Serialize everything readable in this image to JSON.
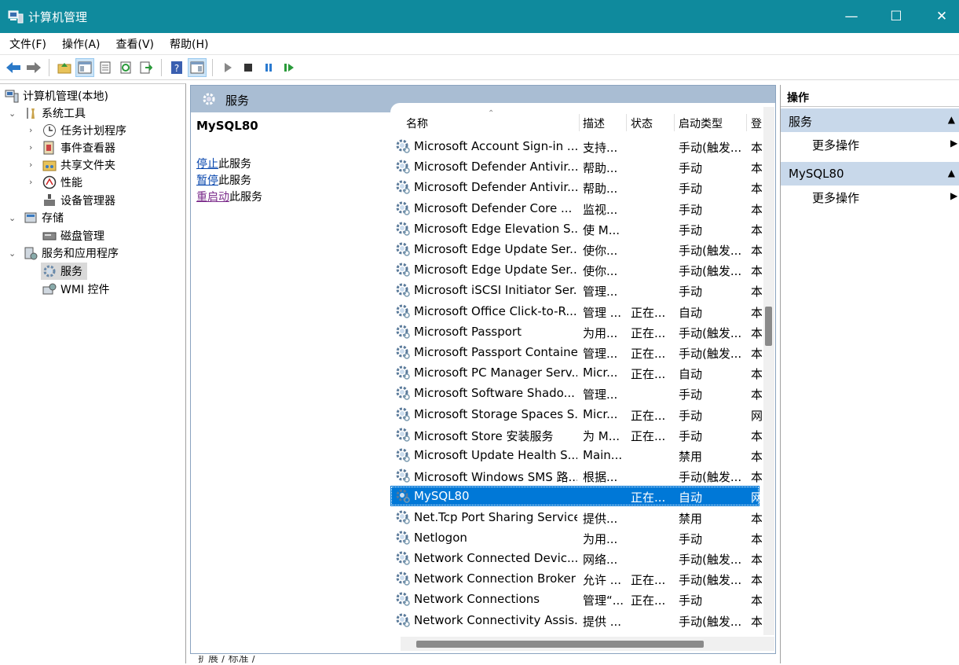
{
  "window": {
    "title": "计算机管理",
    "minimize": "—",
    "maximize": "☐",
    "close": "✕"
  },
  "menu": [
    "文件(F)",
    "操作(A)",
    "查看(V)",
    "帮助(H)"
  ],
  "toolbar_icons": [
    "back-icon",
    "forward-icon",
    "up-folder-icon",
    "show-tree-icon",
    "properties-icon",
    "refresh-icon",
    "export-icon",
    "help-icon",
    "show-pane-icon",
    "play-icon",
    "stop-icon",
    "pause-icon",
    "restart-icon"
  ],
  "tree": {
    "root": "计算机管理(本地)",
    "items": [
      "系统工具",
      "任务计划程序",
      "事件查看器",
      "共享文件夹",
      "性能",
      "设备管理器",
      "存储",
      "磁盘管理",
      "服务和应用程序",
      "服务",
      "WMI 控件"
    ]
  },
  "center": {
    "header": "服务",
    "selected_name": "MySQL80",
    "actions": [
      {
        "link": "停止",
        "rest": "此服务"
      },
      {
        "link": "暂停",
        "rest": "此服务"
      },
      {
        "link": "重启动",
        "rest": "此服务"
      }
    ],
    "columns": [
      "名称",
      "描述",
      "状态",
      "启动类型",
      "登"
    ],
    "rows": [
      [
        "Microsoft Account Sign-in ...",
        "支持...",
        "",
        "手动(触发...",
        "本"
      ],
      [
        "Microsoft Defender Antivir...",
        "帮助...",
        "",
        "手动",
        "本"
      ],
      [
        "Microsoft Defender Antivir...",
        "帮助...",
        "",
        "手动",
        "本"
      ],
      [
        "Microsoft Defender Core ...",
        "监视...",
        "",
        "手动",
        "本"
      ],
      [
        "Microsoft Edge Elevation S...",
        "使 M...",
        "",
        "手动",
        "本"
      ],
      [
        "Microsoft Edge Update Ser...",
        "使你...",
        "",
        "手动(触发...",
        "本"
      ],
      [
        "Microsoft Edge Update Ser...",
        "使你...",
        "",
        "手动(触发...",
        "本"
      ],
      [
        "Microsoft iSCSI Initiator Ser...",
        "管理...",
        "",
        "手动",
        "本"
      ],
      [
        "Microsoft Office Click-to-R...",
        "管理 ...",
        "正在...",
        "自动",
        "本"
      ],
      [
        "Microsoft Passport",
        "为用...",
        "正在...",
        "手动(触发...",
        "本"
      ],
      [
        "Microsoft Passport Container",
        "管理...",
        "正在...",
        "手动(触发...",
        "本"
      ],
      [
        "Microsoft PC Manager Serv...",
        "Micr...",
        "正在...",
        "自动",
        "本"
      ],
      [
        "Microsoft Software Shado...",
        "管理...",
        "",
        "手动",
        "本"
      ],
      [
        "Microsoft Storage Spaces S...",
        "Micr...",
        "正在...",
        "手动",
        "网"
      ],
      [
        "Microsoft Store 安装服务",
        "为 M...",
        "正在...",
        "手动",
        "本"
      ],
      [
        "Microsoft Update Health S...",
        "Main...",
        "",
        "禁用",
        "本"
      ],
      [
        "Microsoft Windows SMS 路...",
        "根据...",
        "",
        "手动(触发...",
        "本"
      ],
      [
        "MySQL80",
        "",
        "正在...",
        "自动",
        "网"
      ],
      [
        "Net.Tcp Port Sharing Service",
        "提供...",
        "",
        "禁用",
        "本"
      ],
      [
        "Netlogon",
        "为用...",
        "",
        "手动",
        "本"
      ],
      [
        "Network Connected Devic...",
        "网络...",
        "",
        "手动(触发...",
        "本"
      ],
      [
        "Network Connection Broker",
        "允许 ...",
        "正在...",
        "手动(触发...",
        "本"
      ],
      [
        "Network Connections",
        "管理“...",
        "正在...",
        "手动",
        "本"
      ],
      [
        "Network Connectivity Assis...",
        "提供 ...",
        "",
        "手动(触发...",
        "本"
      ]
    ],
    "selected_row": 17,
    "tabs": "扩展 / 标准 /"
  },
  "actions_pane": {
    "header": "操作",
    "sections": [
      {
        "title": "服务",
        "item": "更多操作"
      },
      {
        "title": "MySQL80",
        "item": "更多操作"
      }
    ]
  },
  "colors": {
    "titlebar": "#0f8a9d",
    "selection": "#0078d7",
    "band": "#a9bdd3",
    "section": "#c8d8ea"
  }
}
